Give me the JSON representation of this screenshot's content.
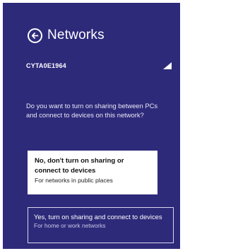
{
  "header": {
    "title": "Networks",
    "back_icon": "back-arrow-circle-icon"
  },
  "network": {
    "name": "CYTA0E1964",
    "signal_icon": "wifi-signal-bars-icon"
  },
  "prompt": {
    "question": "Do you want to turn on sharing between PCs and connect to devices on this network?"
  },
  "options": {
    "no_sharing": {
      "label": "No, don't turn on sharing or connect to devices",
      "description": "For networks in public places"
    },
    "yes_sharing": {
      "label": "Yes, turn on sharing and connect to devices",
      "description": "For home or work networks"
    }
  },
  "colors": {
    "panel_background": "#2e2a7a",
    "selected_option_background": "#ffffff",
    "text": "#ffffff"
  }
}
